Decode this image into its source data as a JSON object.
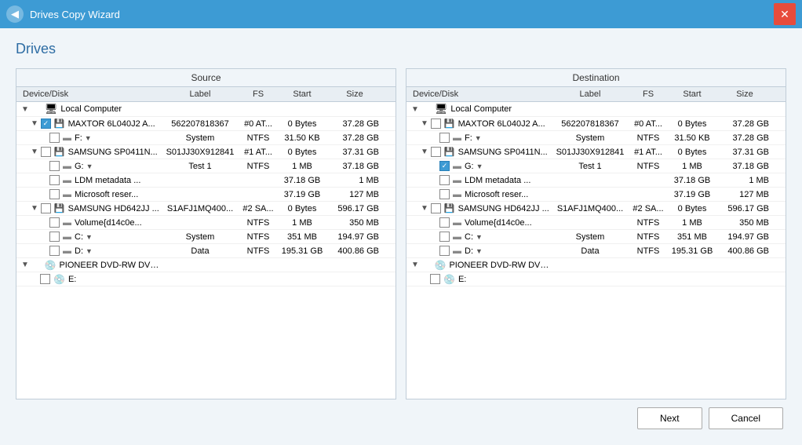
{
  "titlebar": {
    "title": "Drives Copy Wizard",
    "close_label": "✕",
    "back_label": "◀"
  },
  "page_title": "Drives",
  "source_header": "Source",
  "destination_header": "Destination",
  "columns": [
    "Device/Disk",
    "Label",
    "FS",
    "Start",
    "Size"
  ],
  "source_rows": [
    {
      "indent": 1,
      "type": "computer",
      "expand": "collapse",
      "checkbox": false,
      "name": "Local Computer",
      "label": "",
      "fs": "",
      "start": "",
      "size": ""
    },
    {
      "indent": 2,
      "type": "disk",
      "expand": "collapse",
      "checkbox": true,
      "name": "MAXTOR 6L040J2 A...",
      "label": "562207818367",
      "fs": "#0 AT...",
      "start": "0 Bytes",
      "size": "37.28 GB"
    },
    {
      "indent": 3,
      "type": "partition",
      "expand": false,
      "checkbox": false,
      "name": "F:",
      "label": "System",
      "fs": "NTFS",
      "start": "31.50 KB",
      "size": "37.28 GB",
      "dropdown": true
    },
    {
      "indent": 2,
      "type": "disk",
      "expand": "collapse",
      "checkbox": false,
      "name": "SAMSUNG SP0411N...",
      "label": "S01JJ30X912841",
      "fs": "#1 AT...",
      "start": "0 Bytes",
      "size": "37.31 GB"
    },
    {
      "indent": 3,
      "type": "partition",
      "expand": false,
      "checkbox": false,
      "name": "G:",
      "label": "Test 1",
      "fs": "NTFS",
      "start": "1 MB",
      "size": "37.18 GB",
      "dropdown": true
    },
    {
      "indent": 3,
      "type": "partition",
      "expand": false,
      "checkbox": false,
      "name": "LDM metadata ...",
      "label": "",
      "fs": "",
      "start": "37.18 GB",
      "size": "1 MB"
    },
    {
      "indent": 3,
      "type": "partition",
      "expand": false,
      "checkbox": false,
      "name": "Microsoft reser...",
      "label": "",
      "fs": "",
      "start": "37.19 GB",
      "size": "127 MB"
    },
    {
      "indent": 2,
      "type": "disk",
      "expand": "collapse",
      "checkbox": false,
      "name": "SAMSUNG HD642JJ ...",
      "label": "S1AFJ1MQ400...",
      "fs": "#2 SA...",
      "start": "0 Bytes",
      "size": "596.17 GB"
    },
    {
      "indent": 3,
      "type": "partition",
      "expand": false,
      "checkbox": false,
      "name": "Volume{d14c0e...",
      "label": "",
      "fs": "NTFS",
      "start": "1 MB",
      "size": "350 MB"
    },
    {
      "indent": 3,
      "type": "partition",
      "expand": false,
      "checkbox": false,
      "name": "C:",
      "label": "System",
      "fs": "NTFS",
      "start": "351 MB",
      "size": "194.97 GB",
      "dropdown": true
    },
    {
      "indent": 3,
      "type": "partition",
      "expand": false,
      "checkbox": false,
      "name": "D:",
      "label": "Data",
      "fs": "NTFS",
      "start": "195.31 GB",
      "size": "400.86 GB",
      "dropdown": true
    },
    {
      "indent": 1,
      "type": "dvd",
      "expand": "collapse",
      "checkbox": false,
      "name": "PIONEER DVD-RW DVR...",
      "label": "",
      "fs": "",
      "start": "",
      "size": ""
    },
    {
      "indent": 2,
      "type": "dvd2",
      "expand": false,
      "checkbox": false,
      "name": "E:",
      "label": "",
      "fs": "",
      "start": "",
      "size": ""
    }
  ],
  "destination_rows": [
    {
      "indent": 1,
      "type": "computer",
      "expand": "collapse",
      "checkbox": false,
      "name": "Local Computer",
      "label": "",
      "fs": "",
      "start": "",
      "size": ""
    },
    {
      "indent": 2,
      "type": "disk",
      "expand": "collapse",
      "checkbox": false,
      "name": "MAXTOR 6L040J2 A...",
      "label": "562207818367",
      "fs": "#0 AT...",
      "start": "0 Bytes",
      "size": "37.28 GB"
    },
    {
      "indent": 3,
      "type": "partition",
      "expand": false,
      "checkbox": false,
      "name": "F:",
      "label": "System",
      "fs": "NTFS",
      "start": "31.50 KB",
      "size": "37.28 GB",
      "dropdown": true
    },
    {
      "indent": 2,
      "type": "disk",
      "expand": "collapse",
      "checkbox": false,
      "name": "SAMSUNG SP0411N...",
      "label": "S01JJ30X912841",
      "fs": "#1 AT...",
      "start": "0 Bytes",
      "size": "37.31 GB"
    },
    {
      "indent": 3,
      "type": "partition",
      "expand": false,
      "checkbox": true,
      "name": "G:",
      "label": "Test 1",
      "fs": "NTFS",
      "start": "1 MB",
      "size": "37.18 GB",
      "dropdown": true
    },
    {
      "indent": 3,
      "type": "partition",
      "expand": false,
      "checkbox": false,
      "name": "LDM metadata ...",
      "label": "",
      "fs": "",
      "start": "37.18 GB",
      "size": "1 MB"
    },
    {
      "indent": 3,
      "type": "partition",
      "expand": false,
      "checkbox": false,
      "name": "Microsoft reser...",
      "label": "",
      "fs": "",
      "start": "37.19 GB",
      "size": "127 MB"
    },
    {
      "indent": 2,
      "type": "disk",
      "expand": "collapse",
      "checkbox": false,
      "name": "SAMSUNG HD642JJ ...",
      "label": "S1AFJ1MQ400...",
      "fs": "#2 SA...",
      "start": "0 Bytes",
      "size": "596.17 GB"
    },
    {
      "indent": 3,
      "type": "partition",
      "expand": false,
      "checkbox": false,
      "name": "Volume{d14c0e...",
      "label": "",
      "fs": "NTFS",
      "start": "1 MB",
      "size": "350 MB"
    },
    {
      "indent": 3,
      "type": "partition",
      "expand": false,
      "checkbox": false,
      "name": "C:",
      "label": "System",
      "fs": "NTFS",
      "start": "351 MB",
      "size": "194.97 GB",
      "dropdown": true
    },
    {
      "indent": 3,
      "type": "partition",
      "expand": false,
      "checkbox": false,
      "name": "D:",
      "label": "Data",
      "fs": "NTFS",
      "start": "195.31 GB",
      "size": "400.86 GB",
      "dropdown": true
    },
    {
      "indent": 1,
      "type": "dvd",
      "expand": "collapse",
      "checkbox": false,
      "name": "PIONEER DVD-RW DVR...",
      "label": "",
      "fs": "",
      "start": "",
      "size": ""
    },
    {
      "indent": 2,
      "type": "dvd2",
      "expand": false,
      "checkbox": false,
      "name": "E:",
      "label": "",
      "fs": "",
      "start": "",
      "size": ""
    }
  ],
  "buttons": {
    "next": "Next",
    "cancel": "Cancel"
  }
}
